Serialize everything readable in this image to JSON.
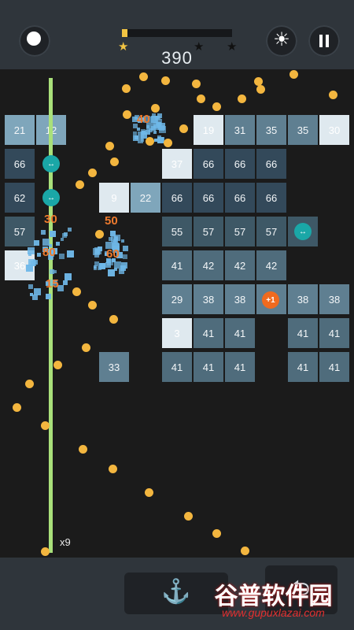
{
  "header": {
    "score": "390",
    "progress": 0.05,
    "stars": [
      "filled",
      "empty",
      "empty"
    ],
    "buttons": {
      "left": "ball-icon",
      "brightness": "sun-icon",
      "pause": "pause-icon"
    }
  },
  "game": {
    "ball_count_label": "x9",
    "floating_numbers": [
      "40",
      "30",
      "50",
      "80",
      "60",
      "15"
    ],
    "bricks": [
      [
        "21",
        "12",
        "",
        "",
        "",
        "",
        "19",
        "31",
        "35",
        "35",
        "30"
      ],
      [
        "66",
        "",
        "",
        "",
        "",
        "37",
        "66",
        "66",
        "66",
        "",
        ""
      ],
      [
        "62",
        "",
        "",
        "9",
        "22",
        "66",
        "66",
        "66",
        "66",
        "",
        ""
      ],
      [
        "57",
        "",
        "",
        "",
        "",
        "55",
        "57",
        "57",
        "57",
        "57",
        ""
      ],
      [
        "36",
        "",
        "",
        "",
        "",
        "41",
        "42",
        "42",
        "42",
        "",
        ""
      ],
      [
        "",
        "",
        "",
        "",
        "",
        "29",
        "38",
        "38",
        "38",
        "",
        "38",
        "38"
      ],
      [
        "",
        "",
        "",
        "",
        "",
        "3",
        "41",
        "41",
        "",
        "",
        "41",
        "41"
      ],
      [
        "",
        "",
        "",
        "33",
        "",
        "41",
        "41",
        "41",
        "",
        "",
        "41",
        "41"
      ]
    ],
    "powerups": [
      {
        "type": "split-icon",
        "label": "",
        "color": "#1aa7a7"
      },
      {
        "type": "plus-ball-icon",
        "label": "+1",
        "color": "#ef6a1f"
      }
    ]
  },
  "footer": {
    "launch_icon": "anchor-icon",
    "watermark": "谷普软件园",
    "watermark_url": "www.gupuxlazai.com"
  },
  "colors": {
    "brick_light": "#e8f1f6",
    "brick_mid": "#8fb1c5",
    "brick_dark": "#3c5462",
    "ball": "#f3b63f",
    "laser": "#a9e07a"
  }
}
